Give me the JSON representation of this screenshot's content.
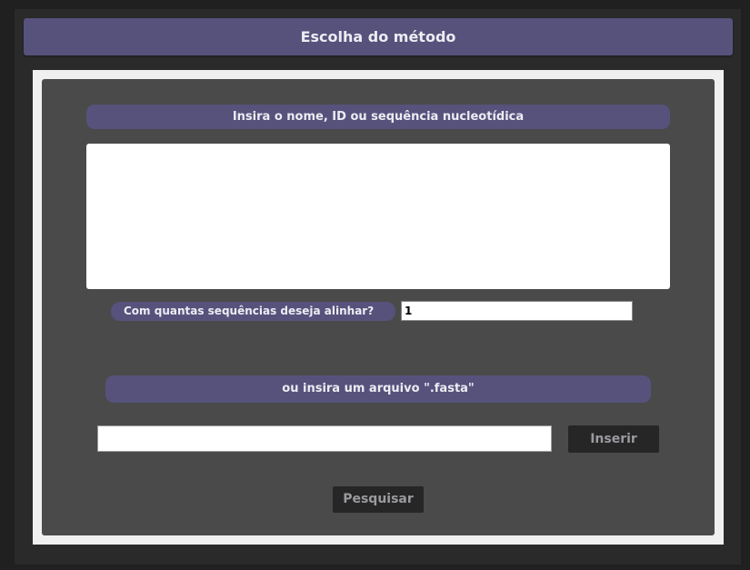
{
  "header": {
    "title": "Escolha do método"
  },
  "sequence": {
    "label": "Insira o nome, ID ou sequência nucleotídica",
    "value": ""
  },
  "count": {
    "label": "Com quantas sequências deseja alinhar?",
    "value": "1"
  },
  "fasta": {
    "label": "ou insira um arquivo \".fasta\"",
    "path_value": "",
    "insert_label": "Inserir"
  },
  "actions": {
    "search_label": "Pesquisar"
  },
  "colors": {
    "accent": "#56527c",
    "panel": "#4a4a4a",
    "background": "#202020",
    "button": "#262626"
  }
}
